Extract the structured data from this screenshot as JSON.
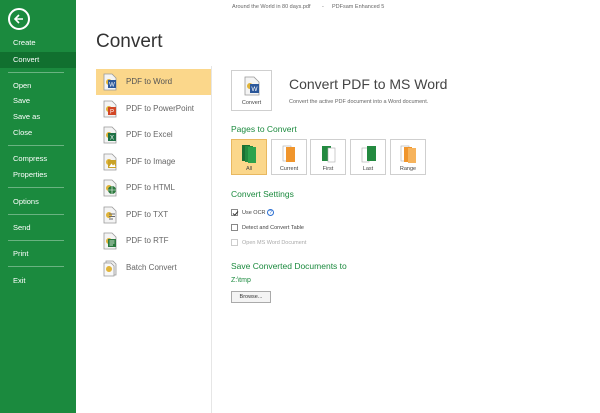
{
  "window": {
    "document_title": "Around the World in 80 days.pdf",
    "separator": "-",
    "app_title": "PDFsam Enhanced 5"
  },
  "sidebar": {
    "items": [
      "Create",
      "Convert",
      "Open",
      "Save",
      "Save as",
      "Close",
      "Compress",
      "Properties",
      "Options",
      "Send",
      "Print",
      "Exit"
    ],
    "active": "Convert"
  },
  "page": {
    "title": "Convert"
  },
  "conversions": [
    {
      "label": "PDF to Word",
      "icon": "word-doc-icon",
      "color": "#2b579a"
    },
    {
      "label": "PDF to PowerPoint",
      "icon": "powerpoint-doc-icon",
      "color": "#d24726"
    },
    {
      "label": "PDF to Excel",
      "icon": "excel-doc-icon",
      "color": "#1e7145"
    },
    {
      "label": "PDF to Image",
      "icon": "image-doc-icon",
      "color": "#c9a227"
    },
    {
      "label": "PDF to HTML",
      "icon": "html-doc-icon",
      "color": "#2c7a3e"
    },
    {
      "label": "PDF to TXT",
      "icon": "txt-doc-icon",
      "color": "#6a6a6a"
    },
    {
      "label": "PDF to RTF",
      "icon": "rtf-doc-icon",
      "color": "#2c7a3e"
    },
    {
      "label": "Batch Convert",
      "icon": "batch-convert-icon",
      "color": "#8a8a8a"
    }
  ],
  "convert_panel": {
    "button_label": "Convert",
    "heading": "Convert PDF to MS Word",
    "description": "Convert the active PDF document into a Word document."
  },
  "pages_to_convert": {
    "title": "Pages to Convert",
    "options": [
      "All",
      "Current",
      "First",
      "Last",
      "Range"
    ],
    "selected": "All"
  },
  "convert_settings": {
    "title": "Convert Settings",
    "use_ocr": {
      "label": "Use OCR",
      "checked": true,
      "help": "?"
    },
    "detect_tables": {
      "label": "Detect and Convert Table",
      "checked": false
    },
    "open_word": {
      "label": "Open MS Word Document",
      "checked": false,
      "enabled": false
    }
  },
  "save_section": {
    "title": "Save Converted Documents to",
    "path": "Z:\\tmp",
    "browse_label": "Browse..."
  },
  "colors": {
    "accent_green": "#1b8a3e",
    "active_green": "#11702f",
    "highlight": "#fbd78b"
  }
}
